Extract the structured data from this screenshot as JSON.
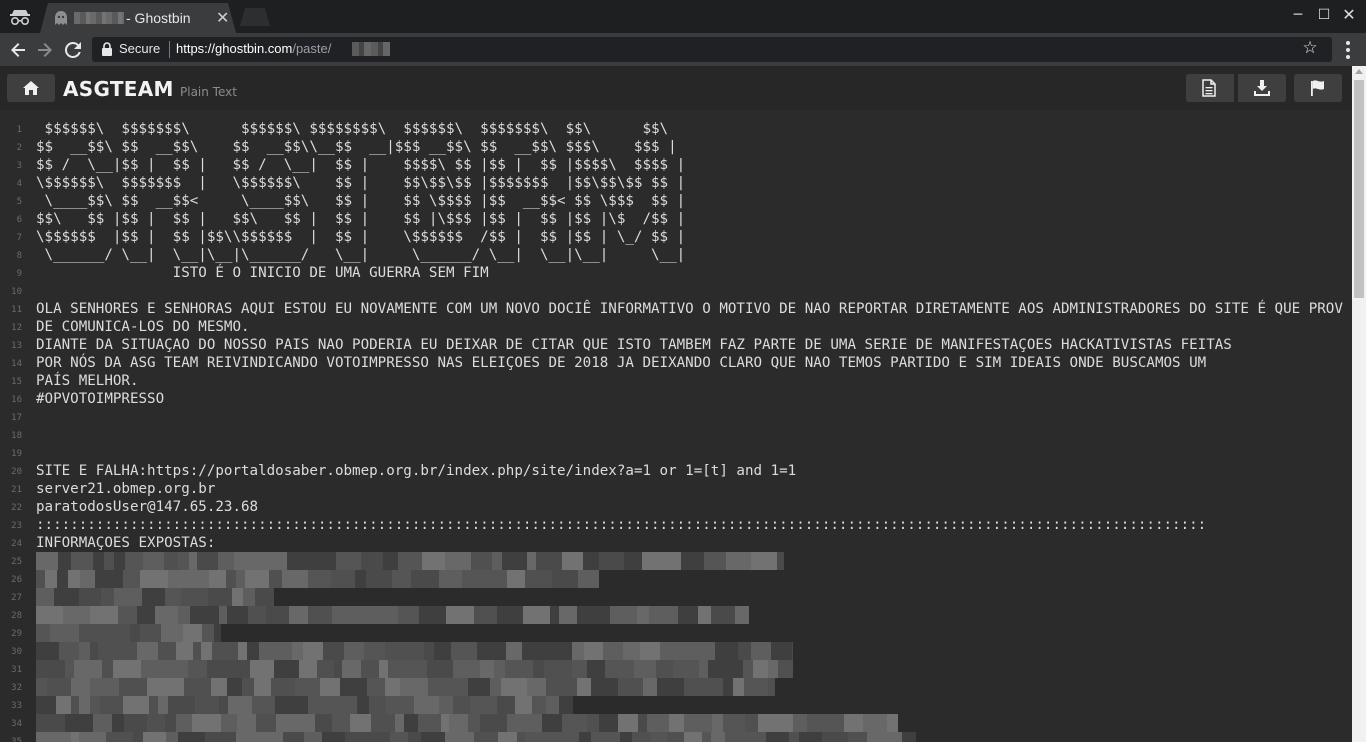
{
  "browser": {
    "tab_title": "- Ghostbin",
    "tab_close": "✕",
    "url_domain": "https://ghostbin.com",
    "url_path": "/paste/",
    "secure_label": "Secure",
    "window_controls": {
      "minimize": "─",
      "maximize": "☐",
      "close": "✕"
    },
    "icons": [
      "incognito-icon",
      "ghost-favicon-icon",
      "back-arrow-icon",
      "forward-arrow-icon",
      "reload-icon",
      "lock-icon",
      "star-icon",
      "kebab-menu-icon"
    ]
  },
  "paste": {
    "title": "ASGTEAM",
    "language": "Plain Text",
    "buttons": [
      "home-icon",
      "raw-document-icon",
      "download-icon",
      "report-flag-icon"
    ]
  },
  "lines": [
    {
      "n": "1",
      "text": " $$$$$$\\  $$$$$$$\\      $$$$$$\\ $$$$$$$$\\  $$$$$$\\  $$$$$$$\\  $$\\      $$\\ "
    },
    {
      "n": "2",
      "text": "$$  __$$\\ $$  __$$\\    $$  __$$\\\\__$$  __|$$$ __$$\\ $$  __$$\\ $$$\\    $$$ |"
    },
    {
      "n": "3",
      "text": "$$ /  \\__|$$ |  $$ |   $$ /  \\__|  $$ |    $$$$\\ $$ |$$ |  $$ |$$$$\\  $$$$ |"
    },
    {
      "n": "4",
      "text": "\\$$$$$$\\  $$$$$$$  |   \\$$$$$$\\    $$ |    $$\\$$\\$$ |$$$$$$$  |$$\\$$\\$$ $$ |"
    },
    {
      "n": "5",
      "text": " \\____$$\\ $$  __$$<     \\____$$\\   $$ |    $$ \\$$$$ |$$  __$$< $$ \\$$$  $$ |"
    },
    {
      "n": "6",
      "text": "$$\\   $$ |$$ |  $$ |   $$\\   $$ |  $$ |    $$ |\\$$$ |$$ |  $$ |$$ |\\$  /$$ |"
    },
    {
      "n": "7",
      "text": "\\$$$$$$  |$$ |  $$ |$$\\\\$$$$$$  |  $$ |    \\$$$$$$  /$$ |  $$ |$$ | \\_/ $$ |"
    },
    {
      "n": "8",
      "text": " \\______/ \\__|  \\__|\\__|\\______/   \\__|     \\______/ \\__|  \\__|\\__|     \\__|"
    },
    {
      "n": "9",
      "text": "                ISTO É O INICIO DE UMA GUERRA SEM FIM"
    },
    {
      "n": "10",
      "text": ""
    },
    {
      "n": "11",
      "text": "OLA SENHORES E SENHORAS AQUI ESTOU EU NOVAMENTE COM UM NOVO DOCIÊ INFORMATIVO O MOTIVO DE NAO REPORTAR DIRETAMENTE AOS ADMINISTRADORES DO SITE É QUE PROV"
    },
    {
      "n": "12",
      "text": "DE COMUNICA-LOS DO MESMO."
    },
    {
      "n": "13",
      "text": "DIANTE DA SITUAÇAO DO NOSSO PAIS NAO PODERIA EU DEIXAR DE CITAR QUE ISTO TAMBEM FAZ PARTE DE UMA SERIE DE MANIFESTAÇOES HACKATIVISTAS FEITAS"
    },
    {
      "n": "14",
      "text": "POR NÓS DA ASG TEAM REIVINDICANDO VOTOIMPRESSO NAS ELEIÇOES DE 2018 JA DEIXANDO CLARO QUE NAO TEMOS PARTIDO E SIM IDEAIS ONDE BUSCAMOS UM"
    },
    {
      "n": "15",
      "text": "PAÍS MELHOR."
    },
    {
      "n": "16",
      "text": "#OPVOTOIMPRESSO"
    },
    {
      "n": "17",
      "text": ""
    },
    {
      "n": "18",
      "text": ""
    },
    {
      "n": "19",
      "text": ""
    },
    {
      "n": "20",
      "text": "SITE E FALHA:https://portaldosaber.obmep.org.br/index.php/site/index?a=1 or 1=[t] and 1=1"
    },
    {
      "n": "21",
      "text": "server21.obmep.org.br"
    },
    {
      "n": "22",
      "text": "paratodosUser@147.65.23.68"
    },
    {
      "n": "23",
      "text": ":::::::::::::::::::::::::::::::::::::::::::::::::::::::::::::::::::::::::::::::::::::::::::::::::::::::::::::::::::::::::::::::::::::::::"
    },
    {
      "n": "24",
      "text": "INFORMAÇOES EXPOSTAS:"
    }
  ],
  "redacted_line_numbers": [
    "25",
    "26",
    "27",
    "28",
    "29",
    "30",
    "31",
    "32",
    "33",
    "34",
    "35"
  ],
  "redacted_widths": [
    0.85,
    0.64,
    0.27,
    0.81,
    0.21,
    0.86,
    0.86,
    0.84,
    0.61,
    0.98,
    1.0
  ]
}
